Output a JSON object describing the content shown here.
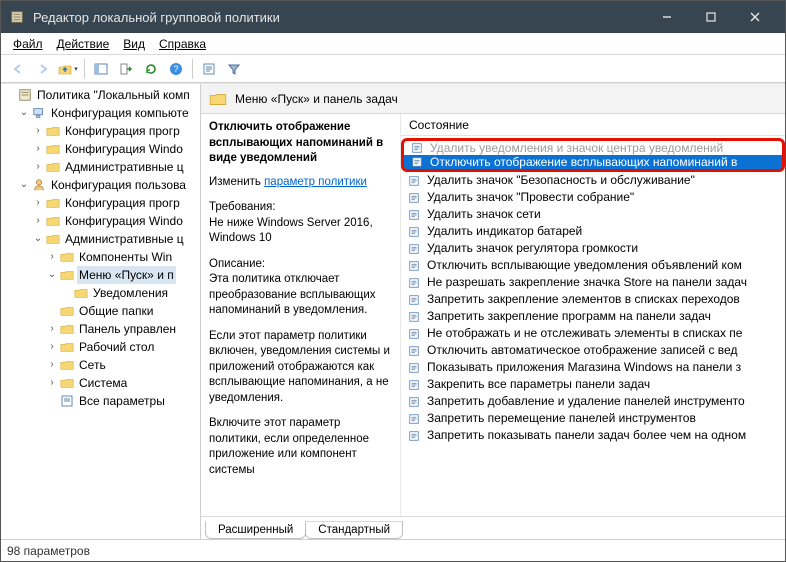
{
  "window": {
    "title": "Редактор локальной групповой политики"
  },
  "menu": [
    "Файл",
    "Действие",
    "Вид",
    "Справка"
  ],
  "toolbar_icons": [
    "back",
    "forward",
    "up",
    "show-hide",
    "export",
    "refresh",
    "help",
    "props",
    "filter"
  ],
  "tree": {
    "root": {
      "label": "Политика \"Локальный комп"
    },
    "computer": {
      "label": "Конфигурация компьюте",
      "children": [
        {
          "label": "Конфигурация прогр"
        },
        {
          "label": "Конфигурация Windo"
        },
        {
          "label": "Административные ц"
        }
      ]
    },
    "user": {
      "label": "Конфигурация пользова",
      "children_a": [
        {
          "label": "Конфигурация прогр"
        },
        {
          "label": "Конфигурация Windo"
        }
      ],
      "admin": {
        "label": "Административные ц",
        "children_b": [
          {
            "label": "Компоненты Win"
          }
        ],
        "start_menu": {
          "label": "Меню «Пуск» и п",
          "children": [
            {
              "label": "Уведомления"
            }
          ]
        },
        "children_c": [
          {
            "label": "Общие папки"
          },
          {
            "label": "Панель управлен"
          },
          {
            "label": "Рабочий стол"
          },
          {
            "label": "Сеть"
          },
          {
            "label": "Система"
          },
          {
            "label": "Все параметры"
          }
        ]
      }
    }
  },
  "right_header": {
    "title": "Меню «Пуск» и панель задач"
  },
  "info": {
    "title_b": "Отключить отображение всплывающих напоминаний в виде уведомлений",
    "edit_label": "Изменить ",
    "edit_link": "параметр политики",
    "req_head": "Требования:",
    "req_body": "Не ниже Windows Server 2016, Windows 10",
    "desc_head": "Описание:",
    "desc_p1": "Эта политика отключает преобразование всплывающих напоминаний в уведомления.",
    "desc_p2": "Если этот параметр политики включен, уведомления системы и приложений отображаются как всплывающие напоминания, а не уведомления.",
    "desc_p3": "Включите этот параметр политики, если определенное приложение или компонент системы"
  },
  "col_header": "Состояние",
  "policies": [
    "Удалить уведомления и значок центра уведомлений",
    "Отключить отображение всплывающих напоминаний в",
    "Удалить значок \"Безопасность и обслуживание\"",
    "Удалить значок \"Провести собрание\"",
    "Удалить значок сети",
    "Удалить индикатор батарей",
    "Удалить значок регулятора громкости",
    "Отключить всплывающие уведомления объявлений ком",
    "Не разрешать закрепление значка Store на панели задач",
    "Запретить закрепление элементов в списках переходов",
    "Запретить закрепление программ на панели задач",
    "Не отображать и не отслеживать элементы в списках пе",
    "Отключить автоматическое отображение записей с вед",
    "Показывать приложения Магазина Windows на панели з",
    "Закрепить все параметры панели задач",
    "Запретить добавление и удаление панелей инструменто",
    "Запретить перемещение панелей инструментов",
    "Запретить показывать панели задач более чем на одном"
  ],
  "selected_index": 1,
  "tabs": {
    "extended": "Расширенный",
    "standard": "Стандартный"
  },
  "status": "98 параметров"
}
